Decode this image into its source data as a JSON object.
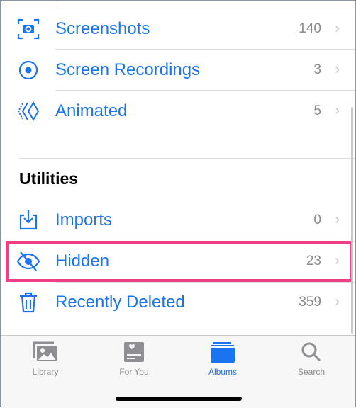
{
  "accent": "#1a73f0",
  "highlight_color": "#ee3e84",
  "media_types": [
    {
      "label": "Screenshots",
      "count": "140",
      "icon": "screenshot-icon"
    },
    {
      "label": "Screen Recordings",
      "count": "3",
      "icon": "screen-recording-icon"
    },
    {
      "label": "Animated",
      "count": "5",
      "icon": "animated-icon"
    }
  ],
  "utilities": {
    "header": "Utilities",
    "items": [
      {
        "label": "Imports",
        "count": "0",
        "icon": "import-icon"
      },
      {
        "label": "Hidden",
        "count": "23",
        "icon": "eye-slash-icon"
      },
      {
        "label": "Recently Deleted",
        "count": "359",
        "icon": "trash-icon"
      }
    ]
  },
  "chevron": "›",
  "tabs": [
    {
      "label": "Library",
      "icon": "library-icon"
    },
    {
      "label": "For You",
      "icon": "for-you-icon"
    },
    {
      "label": "Albums",
      "icon": "albums-icon",
      "selected": true
    },
    {
      "label": "Search",
      "icon": "search-icon"
    }
  ]
}
